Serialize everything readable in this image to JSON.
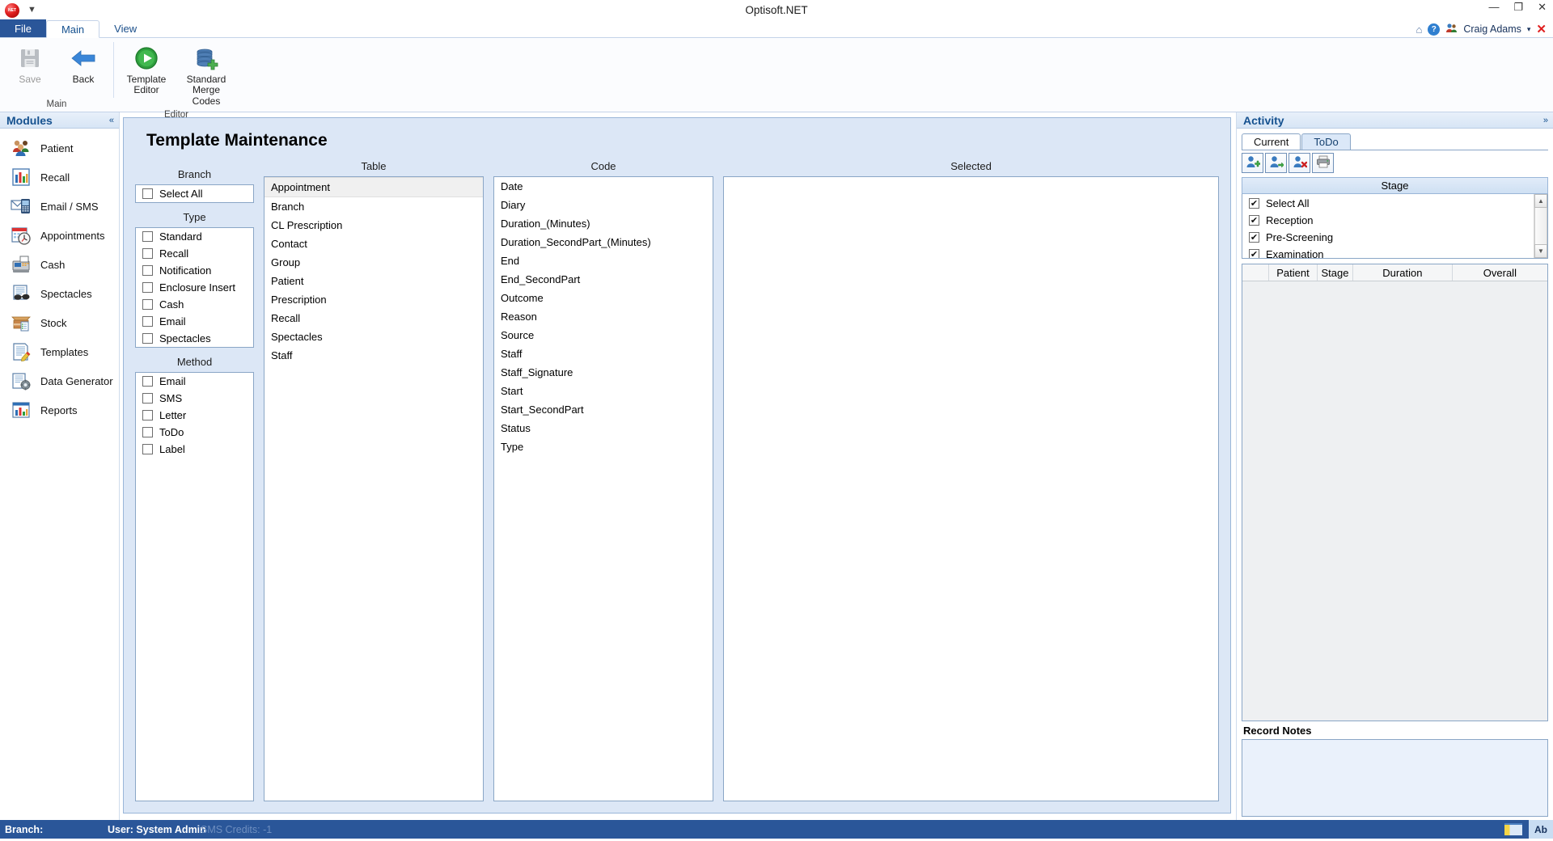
{
  "titlebar": {
    "app_title": "Optisoft.NET",
    "orb_label": "NET",
    "quick_access_dropdown": "▼",
    "minimize": "—",
    "restore": "❐",
    "close": "✕",
    "home_icon": "⌂",
    "help_icon": "?",
    "user_name": "Craig Adams",
    "user_dropdown": "▾",
    "exit_icon": "✕"
  },
  "ribbon": {
    "tabs": [
      {
        "label": "File",
        "type": "file"
      },
      {
        "label": "Main",
        "type": "active"
      },
      {
        "label": "View",
        "type": "normal"
      }
    ],
    "groups": [
      {
        "label": "Main",
        "buttons": [
          {
            "label": "Save",
            "icon": "save-icon",
            "disabled": true
          },
          {
            "label": "Back",
            "icon": "back-arrow-icon",
            "disabled": false
          }
        ]
      },
      {
        "label": "Editor",
        "buttons": [
          {
            "label": "Template\nEditor",
            "line1": "Template",
            "line2": "Editor",
            "icon": "play-circle-icon",
            "disabled": false
          },
          {
            "label": "Standard\nMerge Codes",
            "line1": "Standard",
            "line2": "Merge Codes",
            "icon": "database-add-icon",
            "disabled": false
          }
        ]
      }
    ]
  },
  "sidebar": {
    "header_title": "Modules",
    "collapse_label": "«",
    "items": [
      {
        "label": "Patient",
        "icon": "patients-icon"
      },
      {
        "label": "Recall",
        "icon": "bar-chart-icon"
      },
      {
        "label": "Email / SMS",
        "icon": "email-sms-icon"
      },
      {
        "label": "Appointments",
        "icon": "calendar-clock-icon"
      },
      {
        "label": "Cash",
        "icon": "cash-register-icon"
      },
      {
        "label": "Spectacles",
        "icon": "spectacles-icon"
      },
      {
        "label": "Stock",
        "icon": "stock-box-icon"
      },
      {
        "label": "Templates",
        "icon": "template-pencil-icon"
      },
      {
        "label": "Data Generator",
        "icon": "data-generator-icon"
      },
      {
        "label": "Reports",
        "icon": "reports-icon"
      }
    ]
  },
  "main": {
    "page_title": "Template Maintenance",
    "columns": {
      "branch_header": "Branch",
      "type_header": "Type",
      "method_header": "Method",
      "table_header": "Table",
      "code_header": "Code",
      "selected_header": "Selected"
    },
    "branch_items": [
      {
        "label": "Select All",
        "checked": false
      }
    ],
    "type_items": [
      {
        "label": "Standard",
        "checked": false
      },
      {
        "label": "Recall",
        "checked": false
      },
      {
        "label": "Notification",
        "checked": false
      },
      {
        "label": "Enclosure Insert",
        "checked": false
      },
      {
        "label": "Cash",
        "checked": false
      },
      {
        "label": "Email",
        "checked": false
      },
      {
        "label": "Spectacles",
        "checked": false
      }
    ],
    "method_items": [
      {
        "label": "Email",
        "checked": false
      },
      {
        "label": "SMS",
        "checked": false
      },
      {
        "label": "Letter",
        "checked": false
      },
      {
        "label": "ToDo",
        "checked": false
      },
      {
        "label": "Label",
        "checked": false
      }
    ],
    "table_items": [
      {
        "label": "Appointment",
        "selected": true
      },
      {
        "label": "Branch",
        "selected": false
      },
      {
        "label": "CL Prescription",
        "selected": false
      },
      {
        "label": "Contact",
        "selected": false
      },
      {
        "label": "Group",
        "selected": false
      },
      {
        "label": "Patient",
        "selected": false
      },
      {
        "label": "Prescription",
        "selected": false
      },
      {
        "label": "Recall",
        "selected": false
      },
      {
        "label": "Spectacles",
        "selected": false
      },
      {
        "label": "Staff",
        "selected": false
      }
    ],
    "code_items": [
      {
        "label": "Date"
      },
      {
        "label": "Diary"
      },
      {
        "label": "Duration_(Minutes)"
      },
      {
        "label": "Duration_SecondPart_(Minutes)"
      },
      {
        "label": "End"
      },
      {
        "label": "End_SecondPart"
      },
      {
        "label": "Outcome"
      },
      {
        "label": "Reason"
      },
      {
        "label": "Source"
      },
      {
        "label": "Staff"
      },
      {
        "label": "Staff_Signature"
      },
      {
        "label": "Start"
      },
      {
        "label": "Start_SecondPart"
      },
      {
        "label": "Status"
      },
      {
        "label": "Type"
      }
    ],
    "selected_items": []
  },
  "activity": {
    "header_title": "Activity",
    "expand_label": "»",
    "tabs": [
      {
        "label": "Current",
        "active": true
      },
      {
        "label": "ToDo",
        "active": false
      }
    ],
    "toolbar": [
      {
        "icon": "add-person-icon"
      },
      {
        "icon": "move-person-icon"
      },
      {
        "icon": "remove-person-icon"
      },
      {
        "icon": "print-icon"
      }
    ],
    "stage_header": "Stage",
    "stage_items": [
      {
        "label": "Select All",
        "checked": true
      },
      {
        "label": "Reception",
        "checked": true
      },
      {
        "label": "Pre-Screening",
        "checked": true
      },
      {
        "label": "Examination",
        "checked": true
      }
    ],
    "scroll_up": "▲",
    "scroll_down": "▼",
    "grid_columns": [
      "",
      "Patient",
      "Stage",
      "Duration",
      "Overall"
    ],
    "grid_rows": [],
    "record_notes_label": "Record Notes",
    "record_notes_value": ""
  },
  "statusbar": {
    "branch_label": "Branch:",
    "user_label": "User: System Admin",
    "sms_credits": "SMS Credits: -1",
    "ab_label": "Ab"
  },
  "colors": {
    "ribbon_blue": "#2a5699",
    "panel_blue": "#dce7f6",
    "accent": "#15518f"
  }
}
